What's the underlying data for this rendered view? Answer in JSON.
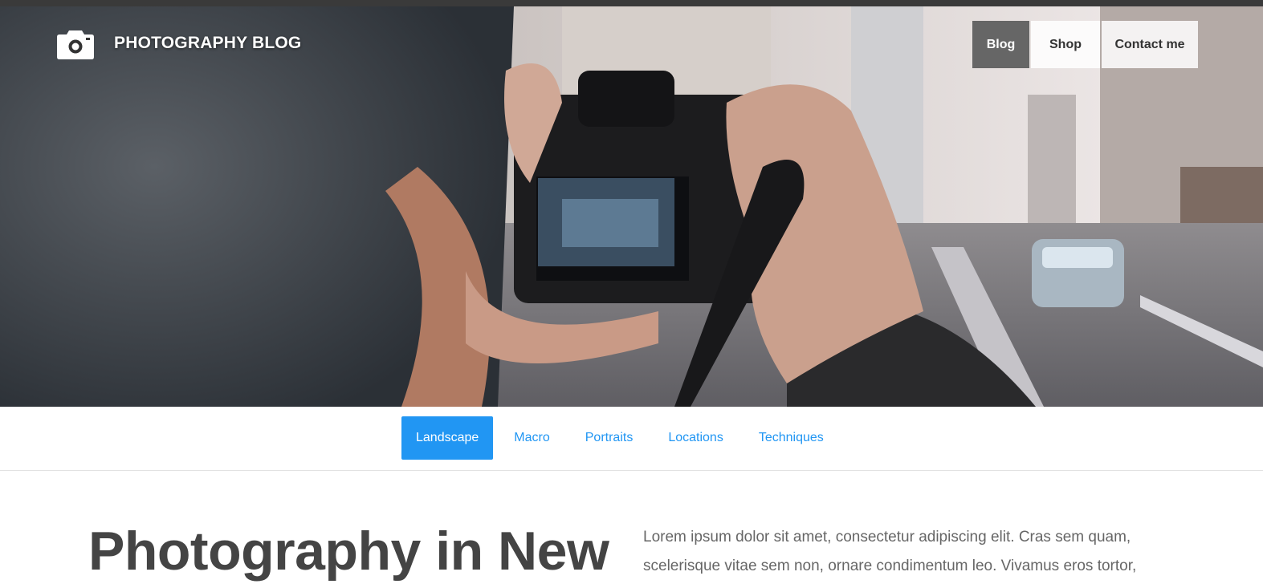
{
  "site": {
    "title": "PHOTOGRAPHY BLOG",
    "logo_icon": "camera-icon"
  },
  "topnav": {
    "items": [
      {
        "label": "Blog",
        "active": true
      },
      {
        "label": "Shop",
        "active": false
      },
      {
        "label": "Contact me",
        "active": false
      }
    ]
  },
  "hero": {
    "image": "photographer-holding-camera-city-street"
  },
  "categories": {
    "items": [
      {
        "label": "Landscape",
        "active": true
      },
      {
        "label": "Macro",
        "active": false
      },
      {
        "label": "Portraits",
        "active": false
      },
      {
        "label": "Locations",
        "active": false
      },
      {
        "label": "Techniques",
        "active": false
      }
    ]
  },
  "article": {
    "heading": "Photography in New",
    "lead_line1": "Lorem ipsum dolor sit amet, consectetur adipiscing elit. Cras sem quam,",
    "lead_line2": "scelerisque vitae sem non, ornare condimentum leo. Vivamus eros tortor,"
  },
  "colors": {
    "accent": "#2196f3",
    "nav_active": "#666666",
    "text": "#444444"
  }
}
